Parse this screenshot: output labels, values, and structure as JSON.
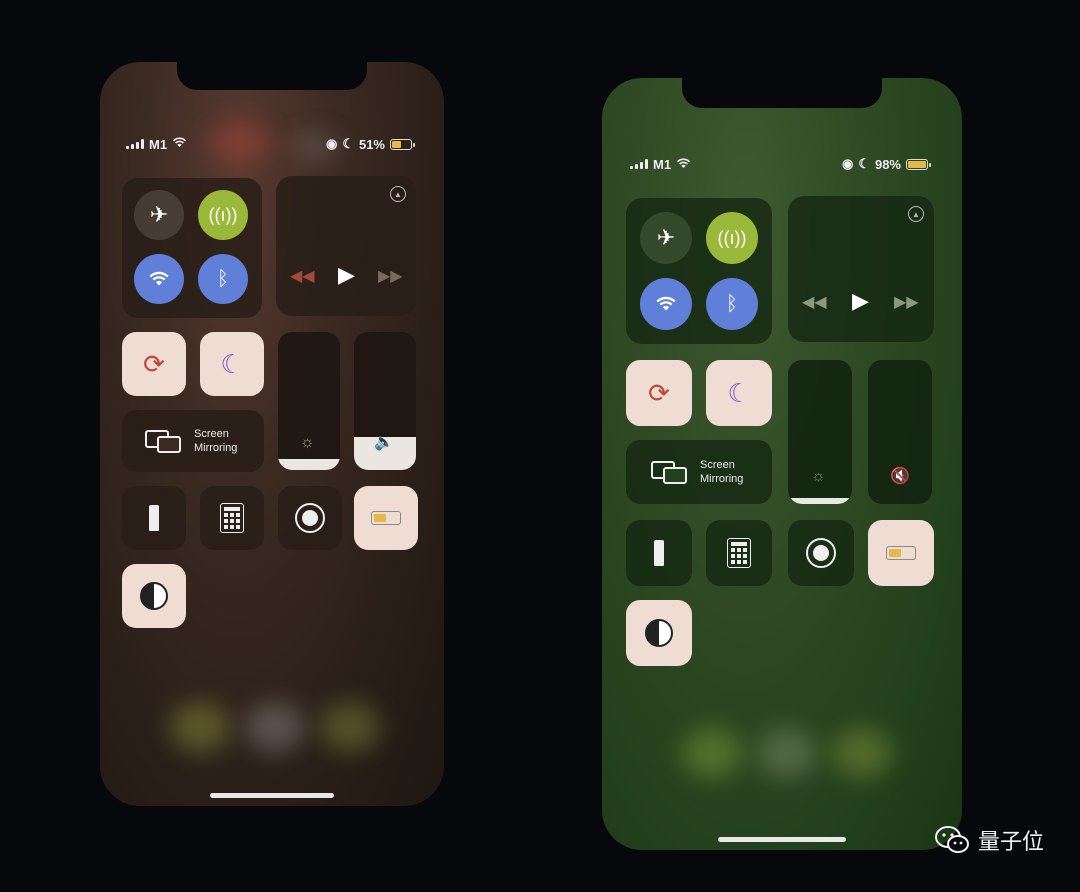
{
  "left_phone": {
    "carrier": "M1",
    "battery_text": "51%",
    "battery_level": 0.51,
    "screen_mirroring_label": "Screen Mirroring",
    "screen_mirroring_line1": "Screen",
    "screen_mirroring_line2": "Mirroring",
    "brightness_level": 0.08,
    "volume_level": 0.24
  },
  "right_phone": {
    "carrier": "M1",
    "battery_text": "98%",
    "battery_level": 0.98,
    "screen_mirroring_line1": "Screen",
    "screen_mirroring_line2": "Mirroring",
    "brightness_level": 0.04,
    "volume_level": 0.0
  },
  "icons": {
    "airplane": "airplane-icon",
    "cellular": "cellular-icon",
    "wifi": "wifi-icon",
    "bluetooth": "bluetooth-icon",
    "airplay": "airplay-icon",
    "rewind": "rewind-icon",
    "play": "play-icon",
    "fast_forward": "fast-forward-icon",
    "rotation_lock": "rotation-lock-icon",
    "do_not_disturb": "moon-icon",
    "screen_mirroring": "screen-mirroring-icon",
    "brightness": "sun-icon",
    "volume": "speaker-icon",
    "flashlight": "flashlight-icon",
    "calculator": "calculator-icon",
    "screen_record": "screen-record-icon",
    "low_power": "battery-icon",
    "dark_mode": "dark-mode-icon"
  },
  "watermark": {
    "text": "量子位"
  },
  "colors": {
    "left_tint": "#3a2a22",
    "right_tint": "#2f4a24",
    "cellular_active": "#9ab83a",
    "wifi_bt_active": "#5f7fd8"
  }
}
